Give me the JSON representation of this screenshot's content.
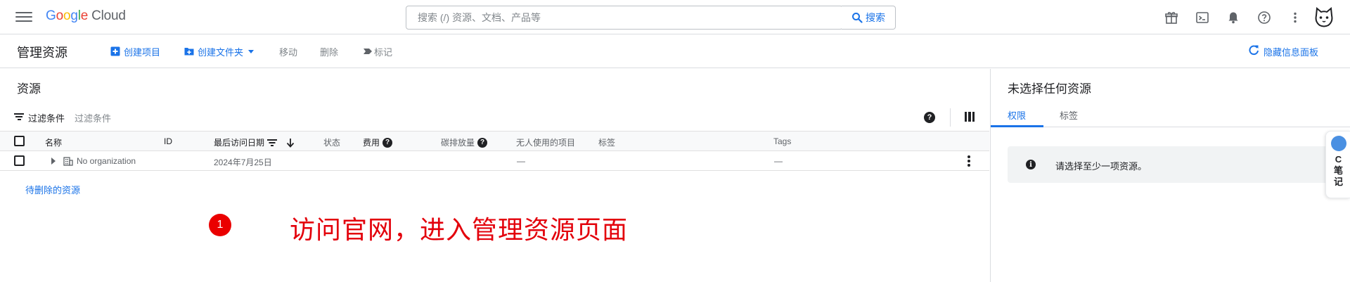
{
  "topbar": {
    "logo_google": "Google",
    "logo_cloud": "Cloud",
    "search_placeholder": "搜索 (/) 资源、文档、产品等",
    "search_button": "搜索",
    "icons": [
      "gift-icon",
      "terminal-icon",
      "bell-icon",
      "help-icon",
      "more-vert-icon",
      "avatar"
    ]
  },
  "toolbar": {
    "title": "管理资源",
    "create_project": "创建项目",
    "create_folder": "创建文件夹",
    "move": "移动",
    "delete": "删除",
    "label": "标记",
    "hide_panel": "隐藏信息面板"
  },
  "resources": {
    "title": "资源",
    "filter_label": "过滤条件",
    "filter_placeholder": "过滤条件",
    "columns": {
      "name": "名称",
      "id": "ID",
      "last_accessed": "最后访问日期",
      "status": "状态",
      "cost": "费用",
      "carbon": "碳排放量",
      "unused": "无人使用的项目",
      "labels": "标签",
      "tags": "Tags"
    },
    "rows": [
      {
        "name": "No organization",
        "id": "",
        "last_accessed": "2024年7月25日",
        "unused": "—",
        "tags": "—"
      }
    ],
    "pending_deletion": "待删除的资源"
  },
  "annotation": {
    "badge": "1",
    "text": "访问官网，进入管理资源页面"
  },
  "info_panel": {
    "title": "未选择任何资源",
    "tabs": [
      "权限",
      "标签"
    ],
    "active_tab": "权限",
    "message": "请选择至少一项资源。"
  },
  "side_widget": {
    "text": "C\n笔\n记"
  },
  "colors": {
    "accent": "#1a73e8",
    "annotation_red": "#e3000b",
    "badge_red": "#ea0000"
  }
}
